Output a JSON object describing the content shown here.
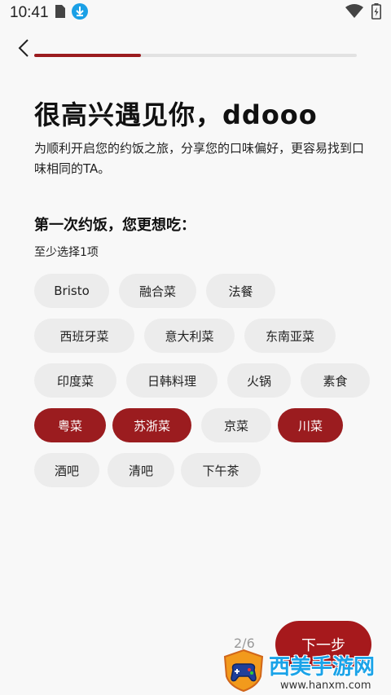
{
  "status_bar": {
    "time": "10:41",
    "icons": [
      "sim-icon",
      "download-icon",
      "wifi-icon",
      "battery-icon"
    ]
  },
  "header": {
    "back_icon": "chevron-left-icon",
    "progress_fraction": 0.33
  },
  "content": {
    "title": "很高兴遇见你，ddooo",
    "intro": "为顺利开启您的约饭之旅，分享您的口味偏好，更容易找到口味相同的TA。",
    "question": "第一次约饭，您更想吃：",
    "hint": "至少选择1项"
  },
  "options": [
    {
      "label": "Bristo",
      "selected": false
    },
    {
      "label": "融合菜",
      "selected": false
    },
    {
      "label": "法餐",
      "selected": false
    },
    {
      "label": "西班牙菜",
      "selected": false
    },
    {
      "label": "意大利菜",
      "selected": false
    },
    {
      "label": "东南亚菜",
      "selected": false
    },
    {
      "label": "印度菜",
      "selected": false
    },
    {
      "label": "日韩料理",
      "selected": false
    },
    {
      "label": "火锅",
      "selected": false
    },
    {
      "label": "素食",
      "selected": false
    },
    {
      "label": "粤菜",
      "selected": true
    },
    {
      "label": "苏浙菜",
      "selected": true
    },
    {
      "label": "京菜",
      "selected": false
    },
    {
      "label": "川菜",
      "selected": true
    },
    {
      "label": "酒吧",
      "selected": false
    },
    {
      "label": "清吧",
      "selected": false
    },
    {
      "label": "下午茶",
      "selected": false
    }
  ],
  "footer": {
    "page_indicator": "2/6",
    "next_label": "下一步"
  },
  "watermark": {
    "title": "西美手游网",
    "url": "www.hanxm.com"
  },
  "colors": {
    "accent": "#9b1c1f",
    "chip_bg": "#ececec",
    "background": "#f8f8f8"
  }
}
